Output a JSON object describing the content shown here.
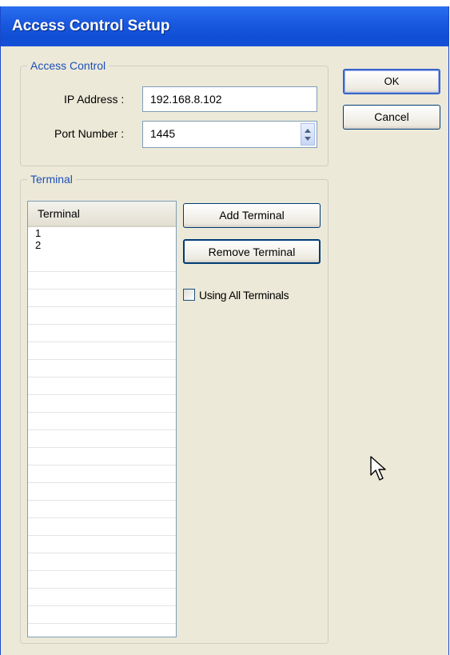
{
  "window": {
    "title": "Access Control Setup"
  },
  "access_control": {
    "legend": "Access Control",
    "ip_label": "IP Address :",
    "ip_value": "192.168.8.102",
    "port_label": "Port Number :",
    "port_value": "1445"
  },
  "terminal": {
    "legend": "Terminal",
    "column_header": "Terminal",
    "rows": [
      "1",
      "2"
    ],
    "add_label": "Add Terminal",
    "remove_label": "Remove Terminal",
    "using_all_label": "Using All Terminals",
    "using_all_checked": false
  },
  "buttons": {
    "ok_label": "OK",
    "cancel_label": "Cancel"
  },
  "icons": {
    "cursor": "mouse-pointer-icon",
    "spin": "spin-arrows-icon"
  },
  "colors": {
    "titlebar": "#1a5ae0",
    "dialog_bg": "#ece9d8",
    "legend": "#1c4fb8"
  }
}
